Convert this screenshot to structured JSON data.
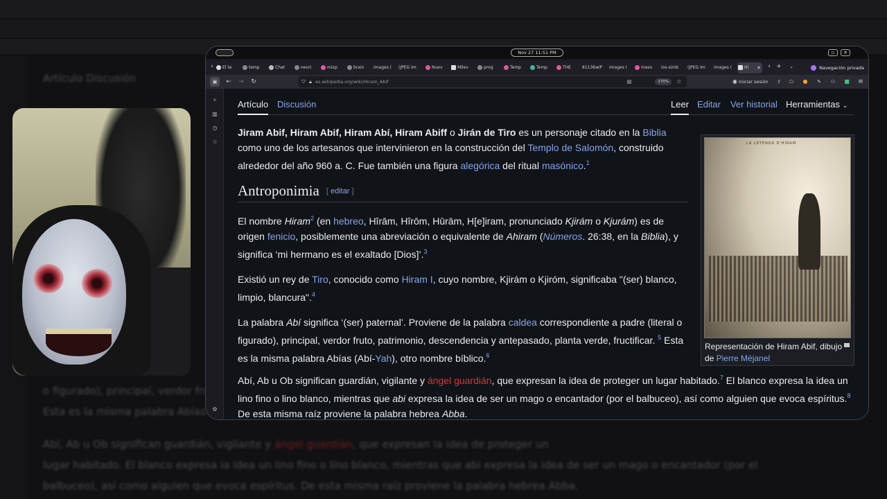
{
  "background": {
    "line1": "Artículo   Discusión",
    "line2": "o figurado), principal, verdor fruto, patrimonio, descendencia y antepasado, planta verde, fructificar.",
    "line3": "Esta es la misma palabra Abías (Abí-Yah), otro nombre bíblico.",
    "line4_a": "Abí, Ab u Ob significan guardián, vigilante y",
    "line4_red": "ángel guardián",
    "line4_b": ", que expresan la idea de proteger un",
    "line5": "lugar habitado. El blanco expresa la idea un lino fino o lino blanco, mientras que abi expresa la idea de ser un mago o encantador (por el",
    "line6": "balbuceo), así como alguien que evoca espíritus. De esta misma raíz proviene la palabra hebrea Abba."
  },
  "titlebar": {
    "clock": "Nov 27  11:51 PM"
  },
  "tabs": [
    {
      "label": "El te"
    },
    {
      "label": "temp"
    },
    {
      "label": "Chat"
    },
    {
      "label": "neuri"
    },
    {
      "label": "mixp"
    },
    {
      "label": "brain"
    },
    {
      "label": "images ("
    },
    {
      "label": "(JPEG Im"
    },
    {
      "label": "Nuev"
    },
    {
      "label": "Milev"
    },
    {
      "label": "prog"
    },
    {
      "label": "Temp"
    },
    {
      "label": "Temp"
    },
    {
      "label": "THE"
    },
    {
      "label": "81136wiP"
    },
    {
      "label": "images ("
    },
    {
      "label": "maso"
    },
    {
      "label": "los-simb"
    },
    {
      "label": "(JPEG Im"
    },
    {
      "label": "images ("
    },
    {
      "label": "Hi"
    }
  ],
  "private_label": "Navegación privada",
  "url": "es.wikipedia.org/wiki/Hiram_Abif",
  "zoom": "170%",
  "login": "Iniciar sesión",
  "page_tabs": {
    "articulo": "Artículo",
    "discusion": "Discusión",
    "leer": "Leer",
    "editar": "Editar",
    "historial": "Ver historial",
    "herramientas": "Herramientas"
  },
  "intro": {
    "b1": "Jiram Abif, Hiram Abif, Hiram Abí, Hiram Abiff",
    "t1": " o ",
    "b2": "Jirán de Tiro",
    "t2": " es un personaje citado en la ",
    "l1": "Biblia",
    "t3": " como uno de los artesanos que intervinieron en la construcción del ",
    "l2": "Templo de Salomón",
    "t4": ", construido alrededor del año 960 a. C. Fue también una figura ",
    "l3": "alegórica",
    "t5": " del ritual ",
    "l4": "masónico",
    "t6": ".",
    "s1": "1"
  },
  "section": {
    "heading": "Antroponimia",
    "edit_open": "[ ",
    "edit": "editar",
    "edit_close": " ]"
  },
  "p1": {
    "t1": "El nombre ",
    "i1": "Hiram",
    "s1": "2",
    "t2": " (en ",
    "l1": "hebreo",
    "t3": ", Hîrām, Hîrōm, Hūrām, H[e]iram, pronunciado ",
    "i2": "Kjirám",
    "t4": " o ",
    "i3": "Kjurám",
    "t5": ") es de origen ",
    "l2": "fenicio",
    "t6": ", posiblemente una abreviación o equivalente de ",
    "i4": "Ahiram",
    "t7": " (",
    "l3": "Números",
    "t8": ". 26:38, en la ",
    "i5": "Biblia",
    "t9": "), y significa ‘mi hermano es el exaltado [Dios]’.",
    "s2": "3"
  },
  "p2": {
    "t1": "Existió un rey de ",
    "l1": "Tiro",
    "t2": ", conocido como ",
    "l2": "Hiram I",
    "t3": ", cuyo nombre, Kjirám o Kjiróm, significaba \"(ser) blanco, limpio, blancura\".",
    "s1": "4"
  },
  "p3": {
    "t1": "La palabra ",
    "i1": "Abí",
    "t2": " significa ‘(ser) paternal’. Proviene de la palabra ",
    "l1": "caldea",
    "t3": " correspondiente a padre (literal o figurado), principal, verdor fruto, patrimonio, descendencia y antepasado, planta verde, fructificar. ",
    "s1": "5",
    "t4": " Esta es la misma palabra Abías (Abí-",
    "l2": "Yah",
    "t5": "), otro nombre bíblico.",
    "s2": "6"
  },
  "p4": {
    "t1": "Abí, Ab u Ob significan guardián, vigilante y ",
    "r1": "ángel guardián",
    "t2": ", que expresan la idea de proteger un lugar habitado.",
    "s1": "7",
    "t3": " El blanco expresa la idea un lino fino o lino blanco, mientras que ",
    "i1": "abi",
    "t4": " expresa la idea de ser un mago o encantador (por el balbuceo), así como alguien que evoca espíritus.",
    "s2": "8",
    "t5": " De esta misma raíz proviene la palabra hebrea ",
    "i2": "Abba",
    "t6": "."
  },
  "infobox": {
    "engraving_title": "LA LEYENDA D'HIRAM",
    "caption_1": "Representación de Hiram Abif, dibujo de ",
    "caption_link": "Pierre Méjanel"
  }
}
